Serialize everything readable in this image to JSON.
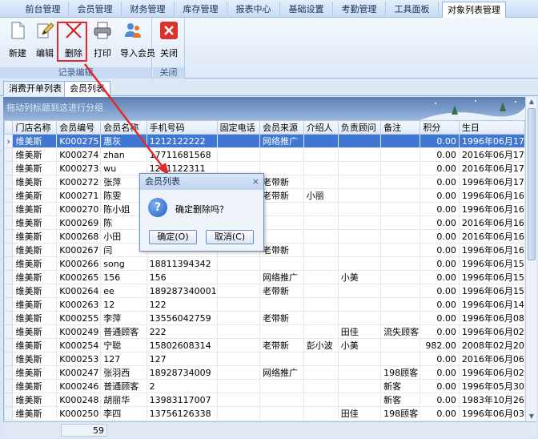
{
  "menu": {
    "tabs": [
      "前台管理",
      "会员管理",
      "财务管理",
      "库存管理",
      "报表中心",
      "基础设置",
      "考勤管理",
      "工具面板",
      "对象列表管理"
    ]
  },
  "ribbon": {
    "group1_label": "记录编辑",
    "group2_label": "关闭",
    "buttons": {
      "new": "新建",
      "edit": "编辑",
      "delete": "删除",
      "print": "打印",
      "import": "导入会员",
      "close": "关闭"
    }
  },
  "subtabs": [
    "消费开单列表",
    "会员列表"
  ],
  "groupbar": {
    "hint": "拖动列标题到这进行分组"
  },
  "grid": {
    "columns": [
      "门店名称",
      "会员编号",
      "会员名称",
      "手机号码",
      "固定电话",
      "会员来源",
      "介绍人",
      "负责顾问",
      "备注",
      "积分",
      "生日"
    ],
    "rows": [
      [
        "维美斯",
        "K000275",
        "惠灰",
        "1212122222",
        "",
        "网络推广",
        "",
        "",
        "",
        "0.00",
        "1996年06月17"
      ],
      [
        "维美斯",
        "K000274",
        "zhan",
        "17711681568",
        "",
        "",
        "",
        "",
        "",
        "0.00",
        "2016年06月17"
      ],
      [
        "维美斯",
        "K000273",
        "wu",
        "1211122311",
        "",
        "",
        "",
        "",
        "",
        "0.00",
        "2016年06月17"
      ],
      [
        "维美斯",
        "K000272",
        "张萍",
        "",
        "",
        "老带新",
        "",
        "",
        "",
        "0.00",
        "1996年06月17"
      ],
      [
        "维美斯",
        "K000271",
        "陈雯",
        "",
        "",
        "老带新",
        "小丽",
        "",
        "",
        "0.00",
        "1996年06月16"
      ],
      [
        "维美斯",
        "K000270",
        "陈小姐",
        "",
        "",
        "",
        "",
        "",
        "",
        "0.00",
        "1996年06月16"
      ],
      [
        "维美斯",
        "K000269",
        "陈",
        "",
        "",
        "",
        "",
        "",
        "",
        "0.00",
        "2016年06月16"
      ],
      [
        "维美斯",
        "K000268",
        "小田",
        "",
        "",
        "",
        "",
        "",
        "",
        "0.00",
        "2016年06月16"
      ],
      [
        "维美斯",
        "K000267",
        "闫",
        "",
        "",
        "老带新",
        "",
        "",
        "",
        "0.00",
        "1996年06月16"
      ],
      [
        "维美斯",
        "K000266",
        "song",
        "18811394342",
        "",
        "",
        "",
        "",
        "",
        "0.00",
        "1996年06月15"
      ],
      [
        "维美斯",
        "K000265",
        "156",
        "156",
        "",
        "网络推广",
        "",
        "小美",
        "",
        "0.00",
        "1996年06月15"
      ],
      [
        "维美斯",
        "K000264",
        "ee",
        "189287340001",
        "",
        "老带新",
        "",
        "",
        "",
        "0.00",
        "1996年06月15"
      ],
      [
        "维美斯",
        "K000263",
        "12",
        "122",
        "",
        "",
        "",
        "",
        "",
        "0.00",
        "1996年06月14"
      ],
      [
        "维美斯",
        "K000255",
        "李萍",
        "13556042759",
        "",
        "老带新",
        "",
        "",
        "",
        "0.00",
        "1996年06月08"
      ],
      [
        "维美斯",
        "K000249",
        "普通顾客",
        "222",
        "",
        "",
        "",
        "田佳",
        "流失顾客",
        "0.00",
        "1996年06月02"
      ],
      [
        "维美斯",
        "K000254",
        "宁聪",
        "15802608314",
        "",
        "老带新",
        "彭小波",
        "小美",
        "",
        "982.00",
        "2008年02月20"
      ],
      [
        "维美斯",
        "K000253",
        "127",
        "127",
        "",
        "",
        "",
        "",
        "",
        "0.00",
        "2016年06月06"
      ],
      [
        "维美斯",
        "K000247",
        "张羽西",
        "18928734009",
        "",
        "网络推广",
        "",
        "",
        "198顾客",
        "0.00",
        "1996年06月02"
      ],
      [
        "维美斯",
        "K000246",
        "普通顾客",
        "2",
        "",
        "",
        "",
        "",
        "新客",
        "0.00",
        "1996年05月30"
      ],
      [
        "维美斯",
        "K000248",
        "胡丽华",
        "13983117007",
        "",
        "",
        "",
        "",
        "新客",
        "0.00",
        "1983年10月26"
      ],
      [
        "维美斯",
        "K000250",
        "李四",
        "13756126338",
        "",
        "",
        "",
        "田佳",
        "198顾客",
        "0.00",
        "1996年06月03"
      ]
    ],
    "selected_row": 0
  },
  "footer": {
    "count": "59"
  },
  "dialog": {
    "title": "会员列表",
    "close_glyph": "×",
    "message": "确定删除吗？",
    "ok": "确定(O)",
    "cancel": "取消(C)"
  },
  "colors": {
    "highlight": "#e32a2a",
    "selection": "#3f77d2"
  }
}
